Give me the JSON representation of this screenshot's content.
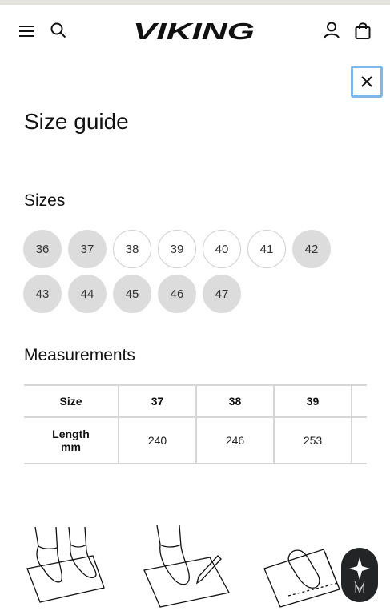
{
  "header": {
    "brand": "VIKING",
    "icons": [
      "menu-icon",
      "search-icon",
      "account-icon",
      "cart-icon"
    ]
  },
  "modal": {
    "title": "Size guide",
    "close_icon": "close-icon"
  },
  "sizes": {
    "title": "Sizes",
    "items": [
      {
        "label": "36",
        "available": false
      },
      {
        "label": "37",
        "available": false
      },
      {
        "label": "38",
        "available": true
      },
      {
        "label": "39",
        "available": true
      },
      {
        "label": "40",
        "available": true
      },
      {
        "label": "41",
        "available": true
      },
      {
        "label": "42",
        "available": false
      },
      {
        "label": "43",
        "available": false
      },
      {
        "label": "44",
        "available": false
      },
      {
        "label": "45",
        "available": false
      },
      {
        "label": "46",
        "available": false
      },
      {
        "label": "47",
        "available": false
      }
    ]
  },
  "measurements": {
    "title": "Measurements",
    "size_header": "Size",
    "length_header_line1": "Length",
    "length_header_line2": "mm",
    "columns": [
      "37",
      "38",
      "39",
      ""
    ],
    "lengths": [
      "240",
      "246",
      "253",
      ""
    ]
  },
  "colors": {
    "unavailable_chip": "#dcdcdc",
    "focus_ring": "#7fb8e8",
    "fab_bg": "#222426"
  }
}
